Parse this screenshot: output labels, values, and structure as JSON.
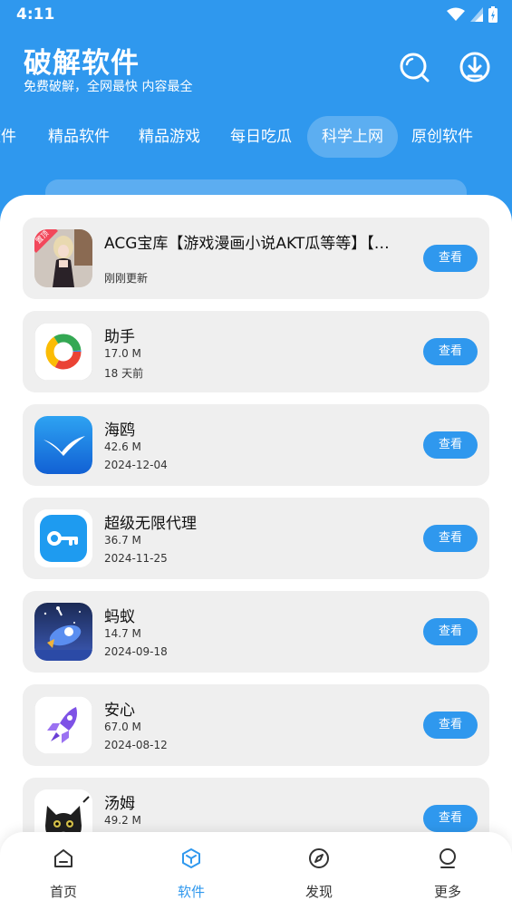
{
  "status_bar": {
    "time": "4:11"
  },
  "header": {
    "title": "破解软件",
    "subtitle": "免费破解，全网最快 内容最全",
    "search_icon": "search-icon",
    "download_icon": "download-icon"
  },
  "tabs": [
    {
      "label": "软件"
    },
    {
      "label": "精品软件"
    },
    {
      "label": "精品游戏"
    },
    {
      "label": "每日吃瓜"
    },
    {
      "label": "科学上网",
      "active": true
    },
    {
      "label": "原创软件"
    }
  ],
  "apps": [
    {
      "name": "ACG宝库【游戏漫画小说AKT瓜等等】【…",
      "badge": "置顶",
      "date": "刚刚更新",
      "button": "查看"
    },
    {
      "name": "助手",
      "size": "17.0 M",
      "date": "18 天前",
      "button": "查看"
    },
    {
      "name": "海鸥",
      "size": "42.6 M",
      "date": "2024-12-04",
      "button": "查看"
    },
    {
      "name": "超级无限代理",
      "size": "36.7 M",
      "date": "2024-11-25",
      "button": "查看"
    },
    {
      "name": "蚂蚁",
      "size": "14.7 M",
      "date": "2024-09-18",
      "button": "查看"
    },
    {
      "name": "安心",
      "size": "67.0 M",
      "date": "2024-08-12",
      "button": "查看"
    },
    {
      "name": "汤姆",
      "size": "49.2 M",
      "date": "",
      "button": "查看"
    }
  ],
  "bottom_nav": [
    {
      "label": "首页",
      "icon": "home-icon"
    },
    {
      "label": "软件",
      "icon": "cube-icon",
      "active": true
    },
    {
      "label": "发现",
      "icon": "compass-icon"
    },
    {
      "label": "更多",
      "icon": "user-icon"
    }
  ],
  "colors": {
    "primary": "#2f98ee",
    "card_bg": "#efefef",
    "badge": "#f2485b"
  }
}
